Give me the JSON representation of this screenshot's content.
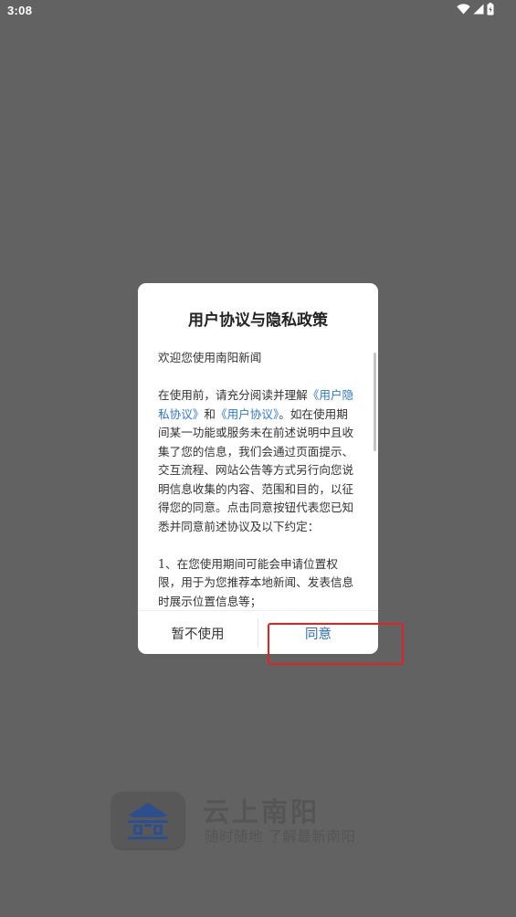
{
  "status_bar": {
    "time": "3:08",
    "icons": [
      "wifi-icon",
      "signal-icon",
      "battery-icon"
    ]
  },
  "dialog": {
    "title": "用户协议与隐私政策",
    "greeting": "欢迎您使用南阳新闻",
    "p1_before": "在使用前，请充分阅读并理解",
    "privacy_link": "《用户隐私协议》",
    "and_text": "和",
    "user_link": "《用户协议》",
    "p1_after": "。如在使用期间某一功能或服务未在前述说明中且收集了您的信息，我们会通过页面提示、交互流程、网站公告等方式另行向您说明信息收集的内容、范围和目的，以征得您的同意。点击同意按钮代表您已知悉并同意前述协议及以下约定：",
    "item1": "1、在您使用期间可能会申请位置权限，用于为您推荐本地新闻、发表信息时展示位置信息等；",
    "cancel_label": "暂不使用",
    "agree_label": "同意"
  },
  "brand": {
    "name": "云上南阳",
    "slogan": "随时随地 了解最新南阳"
  },
  "colors": {
    "overlay": "#626262",
    "link": "#2f78c8",
    "agree": "#2f6db5",
    "highlight": "#e12222"
  }
}
